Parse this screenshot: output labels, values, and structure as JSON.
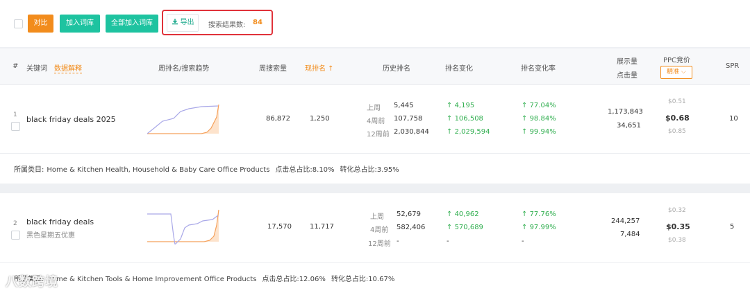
{
  "toolbar": {
    "compare_label": "对比",
    "add_label": "加入词库",
    "add_all_label": "全部加入词库",
    "export_label": "导出",
    "result_label": "搜索结果数:",
    "result_count": "84"
  },
  "header": {
    "index": "#",
    "keyword": "关键词",
    "data_explain": "数据解释",
    "trend": "周排名/搜索趋势",
    "weekly_search": "周搜索量",
    "current_rank": "现排名",
    "history_rank": "历史排名",
    "rank_change": "排名变化",
    "rank_change_rate": "排名变化率",
    "impressions": "展示量",
    "clicks": "点击量",
    "ppc": "PPC竞价",
    "ppc_mode": "精准",
    "spr": "SPR"
  },
  "rows": [
    {
      "index": "1",
      "keyword": "black friday deals 2025",
      "keyword_cn": "",
      "weekly_search": "86,872",
      "current_rank": "1,250",
      "history": [
        {
          "label": "上周",
          "value": "5,445",
          "change": "4,195",
          "rate": "77.04%"
        },
        {
          "label": "4周前",
          "value": "107,758",
          "change": "106,508",
          "rate": "98.84%"
        },
        {
          "label": "12周前",
          "value": "2,030,844",
          "change": "2,029,594",
          "rate": "99.94%"
        }
      ],
      "impressions": "1,173,843",
      "clicks": "34,651",
      "ppc_high": "$0.51",
      "ppc_mid": "$0.68",
      "ppc_low": "$0.85",
      "spr": "10",
      "category_label": "所属类目:",
      "category": "Home & Kitchen Health, Household & Baby Care Office Products",
      "click_share": "点击总占比:8.10%",
      "conv_share": "转化总占比:3.95%"
    },
    {
      "index": "2",
      "keyword": "black friday deals",
      "keyword_cn": "黑色星期五优惠",
      "weekly_search": "17,570",
      "current_rank": "11,717",
      "history": [
        {
          "label": "上周",
          "value": "52,679",
          "change": "40,962",
          "rate": "77.76%"
        },
        {
          "label": "4周前",
          "value": "582,406",
          "change": "570,689",
          "rate": "97.99%"
        },
        {
          "label": "12周前",
          "value": "-",
          "change": "-",
          "rate": "-"
        }
      ],
      "impressions": "244,257",
      "clicks": "7,484",
      "ppc_high": "$0.32",
      "ppc_mid": "$0.35",
      "ppc_low": "$0.38",
      "spr": "5",
      "category_label": "所属类目:",
      "category": "Home & Kitchen Tools & Home Improvement Office Products",
      "click_share": "点击总占比:12.06%",
      "conv_share": "转化总占比:10.67%"
    }
  ],
  "watermark": "八数跨境",
  "colors": {
    "accent": "#f28c1c",
    "teal": "#1ec3a0",
    "highlight": "#e0323a",
    "green": "#2fae4e"
  }
}
